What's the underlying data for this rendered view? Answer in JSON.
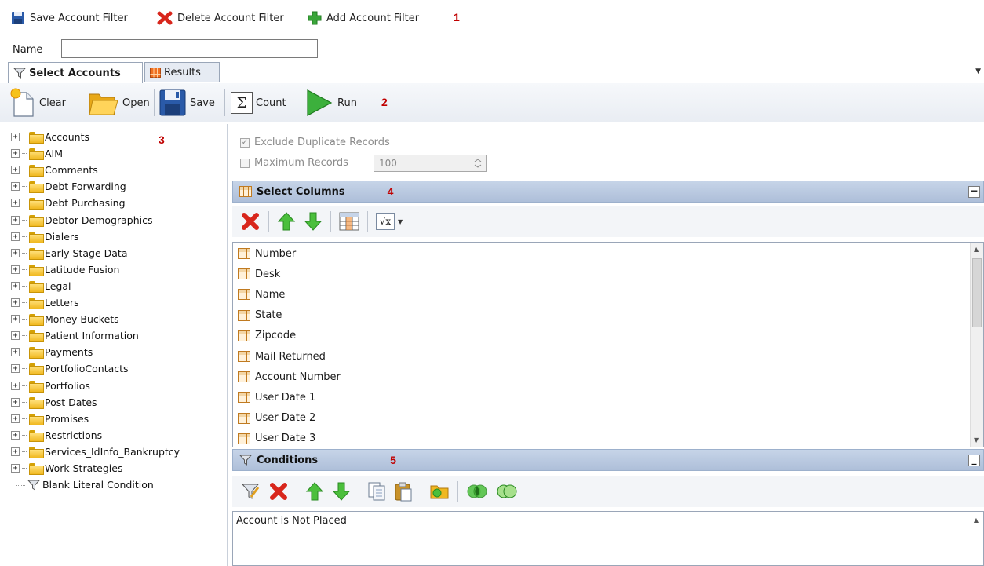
{
  "filter_toolbar": {
    "save_label": "Save Account Filter",
    "delete_label": "Delete Account Filter",
    "add_label": "Add Account Filter",
    "callout": "1"
  },
  "name_field": {
    "label": "Name",
    "value": ""
  },
  "tabs": [
    {
      "label": "Select Accounts",
      "active": true
    },
    {
      "label": "Results",
      "active": false
    }
  ],
  "toolbar": {
    "clear_label": "Clear",
    "open_label": "Open",
    "save_label": "Save",
    "count_label": "Count",
    "run_label": "Run",
    "callout": "2"
  },
  "tree": {
    "callout": "3",
    "items": [
      "Accounts",
      "AIM",
      "Comments",
      "Debt Forwarding",
      "Debt Purchasing",
      "Debtor Demographics",
      "Dialers",
      "Early Stage Data",
      "Latitude Fusion",
      "Legal",
      "Letters",
      "Money Buckets",
      "Patient Information",
      "Payments",
      "PortfolioContacts",
      "Portfolios",
      "Post Dates",
      "Promises",
      "Restrictions",
      "Services_IdInfo_Bankruptcy",
      "Work Strategies"
    ],
    "leaf_item": "Blank Literal Condition"
  },
  "options": {
    "exclude_duplicates_label": "Exclude Duplicate Records",
    "exclude_duplicates_checked": true,
    "max_records_label": "Maximum Records",
    "max_records_checked": false,
    "max_records_value": "100"
  },
  "select_columns": {
    "title": "Select Columns",
    "callout": "4",
    "columns": [
      "Number",
      "Desk",
      "Name",
      "State",
      "Zipcode",
      "Mail Returned",
      "Account Number",
      "User Date 1",
      "User Date 2",
      "User Date 3"
    ]
  },
  "conditions": {
    "title": "Conditions",
    "callout": "5",
    "items": [
      "Account is Not Placed"
    ]
  },
  "colors": {
    "section_header": "#b8c8df",
    "callout": "#c00000",
    "folder": "#f0b820"
  }
}
